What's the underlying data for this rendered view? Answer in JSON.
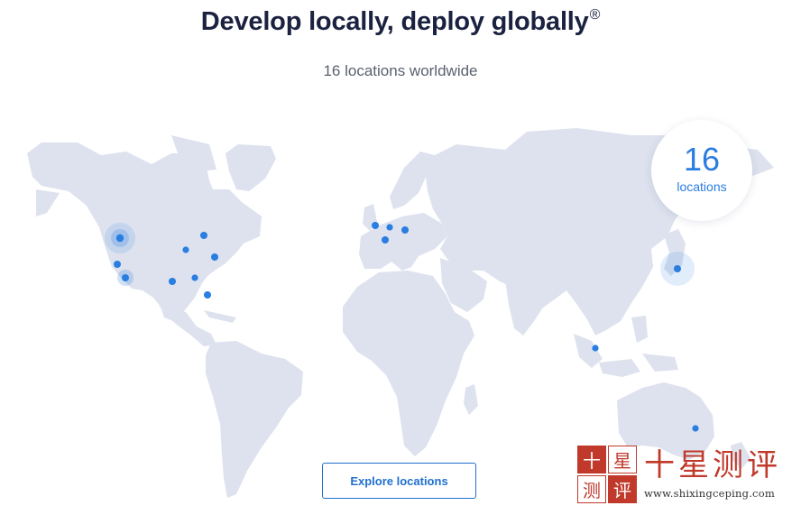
{
  "header": {
    "title": "Develop locally, deploy globally",
    "registered_mark": "®",
    "subtitle": "16 locations worldwide"
  },
  "map": {
    "land_color": "#dde2ee",
    "pin_color": "#2a7de1"
  },
  "badge": {
    "count": "16",
    "label": "locations"
  },
  "cta": {
    "label": "Explore locations"
  },
  "watermark": {
    "seal_chars": [
      "十",
      "星",
      "测",
      "评"
    ],
    "title": "十星测评",
    "url": "www.shixingceping.com"
  }
}
